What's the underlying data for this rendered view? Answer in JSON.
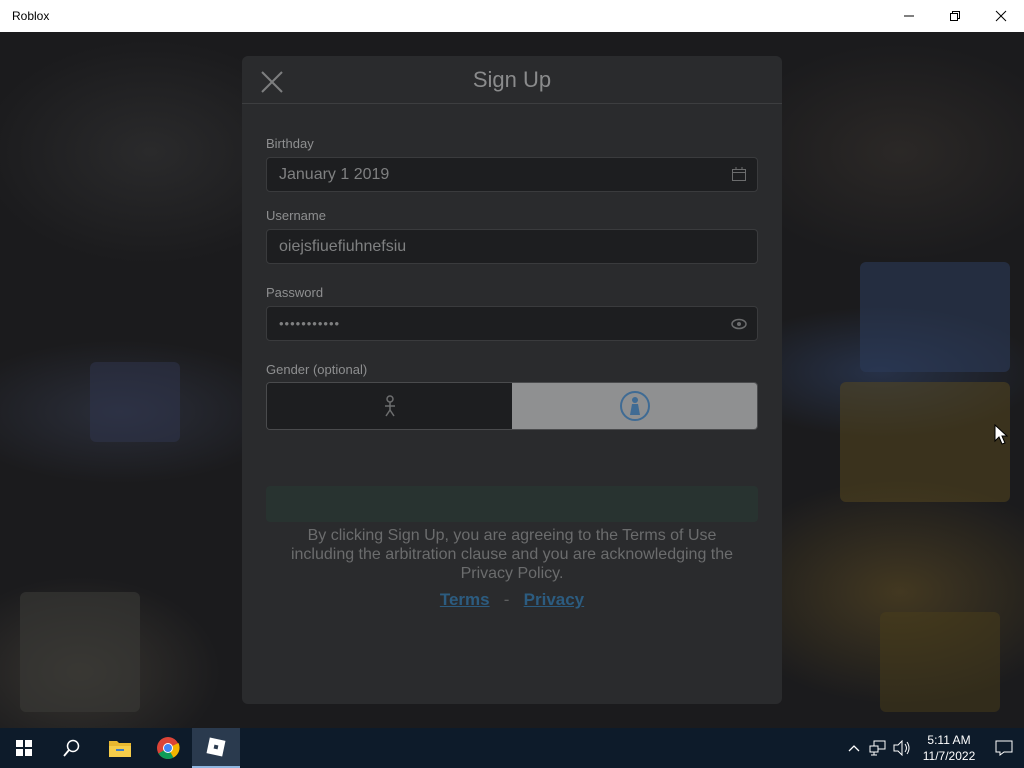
{
  "window": {
    "title": "Roblox"
  },
  "modal": {
    "title": "Sign Up",
    "birthday": {
      "label": "Birthday",
      "value": "January 1 2019"
    },
    "username": {
      "label": "Username",
      "value": "oiejsfiuefiuhnefsiu"
    },
    "password": {
      "label": "Password",
      "value": "•••••••••••"
    },
    "gender": {
      "label": "Gender (optional)",
      "selected": "female"
    },
    "legal_text": "By clicking Sign Up, you are agreeing to the Terms of Use including the arbitration clause and you are acknowledging the Privacy Policy.",
    "terms_link": "Terms",
    "separator": "-",
    "privacy_link": "Privacy"
  },
  "taskbar": {
    "time": "5:11 AM",
    "date": "11/7/2022"
  },
  "colors": {
    "modal_bg": "#2a2b2d",
    "link": "#2c5c80",
    "taskbar": "#0d1b2a"
  }
}
